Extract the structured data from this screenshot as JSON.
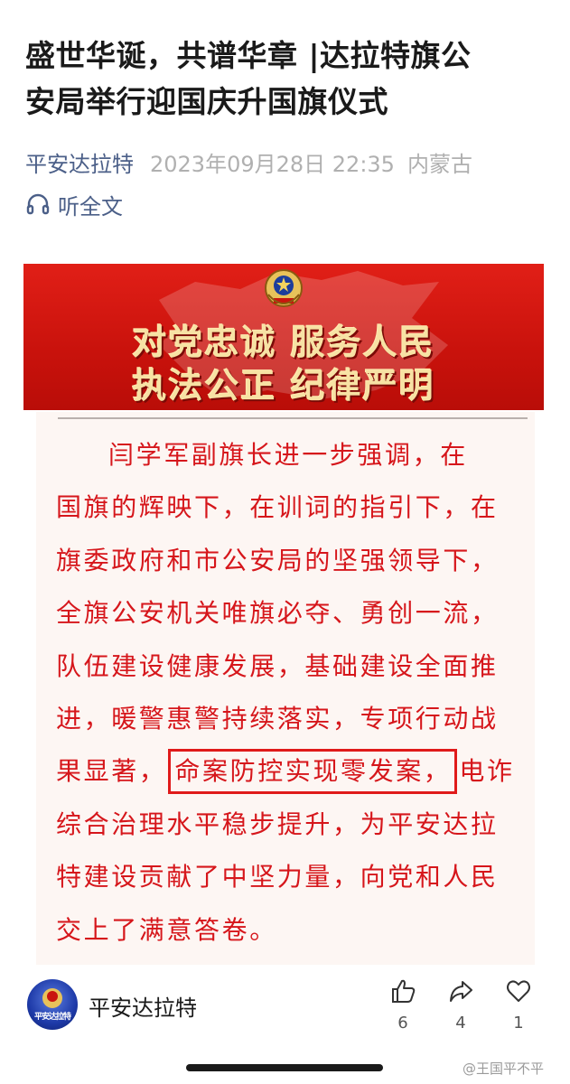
{
  "article": {
    "title_line1": "盛世华诞，共谱华章 |达拉特旗公",
    "title_line2": "安局举行迎国庆升国旗仪式",
    "source": "平安达拉特",
    "date": "2023年09月28日 22:35",
    "region": "内蒙古",
    "listen_label": "听全文",
    "listen_icon": "headphone-icon"
  },
  "banner": {
    "line1": "对党忠诚 服务人民",
    "line2": "执法公正 纪律严明",
    "emblem_icon": "police-emblem-icon",
    "colors": {
      "background": "#d1150e",
      "text": "#f7e2a4"
    }
  },
  "body": {
    "lines": [
      "闫学军副旗长进一步强调，在",
      "国旗的辉映下，在训词的指引下，在",
      "旗委政府和市公安局的坚强领导下，",
      "全旗公安机关唯旗必夺、勇创一流，",
      "队伍建设健康发展，基础建设全面推",
      "进，暖警惠警持续落实，专项行动战"
    ],
    "line7_before": "果显著，",
    "line7_highlight": "命案防控实现零发案，",
    "line7_after": "电诈",
    "lines_after": [
      "综合治理水平稳步提升，为平安达拉",
      "特建设贡献了中坚力量，向党和人民",
      "交上了满意答卷。"
    ],
    "text_color": "#d6161b",
    "highlight_color": "#e01a1a"
  },
  "footer": {
    "account_name": "平安达拉特",
    "avatar_text": "平安达拉特",
    "like_count": "6",
    "share_count": "4",
    "favorite_count": "1",
    "like_icon": "thumbs-up-icon",
    "share_icon": "share-arrow-icon",
    "favorite_icon": "heart-icon",
    "watermark": "@王国平不平"
  }
}
